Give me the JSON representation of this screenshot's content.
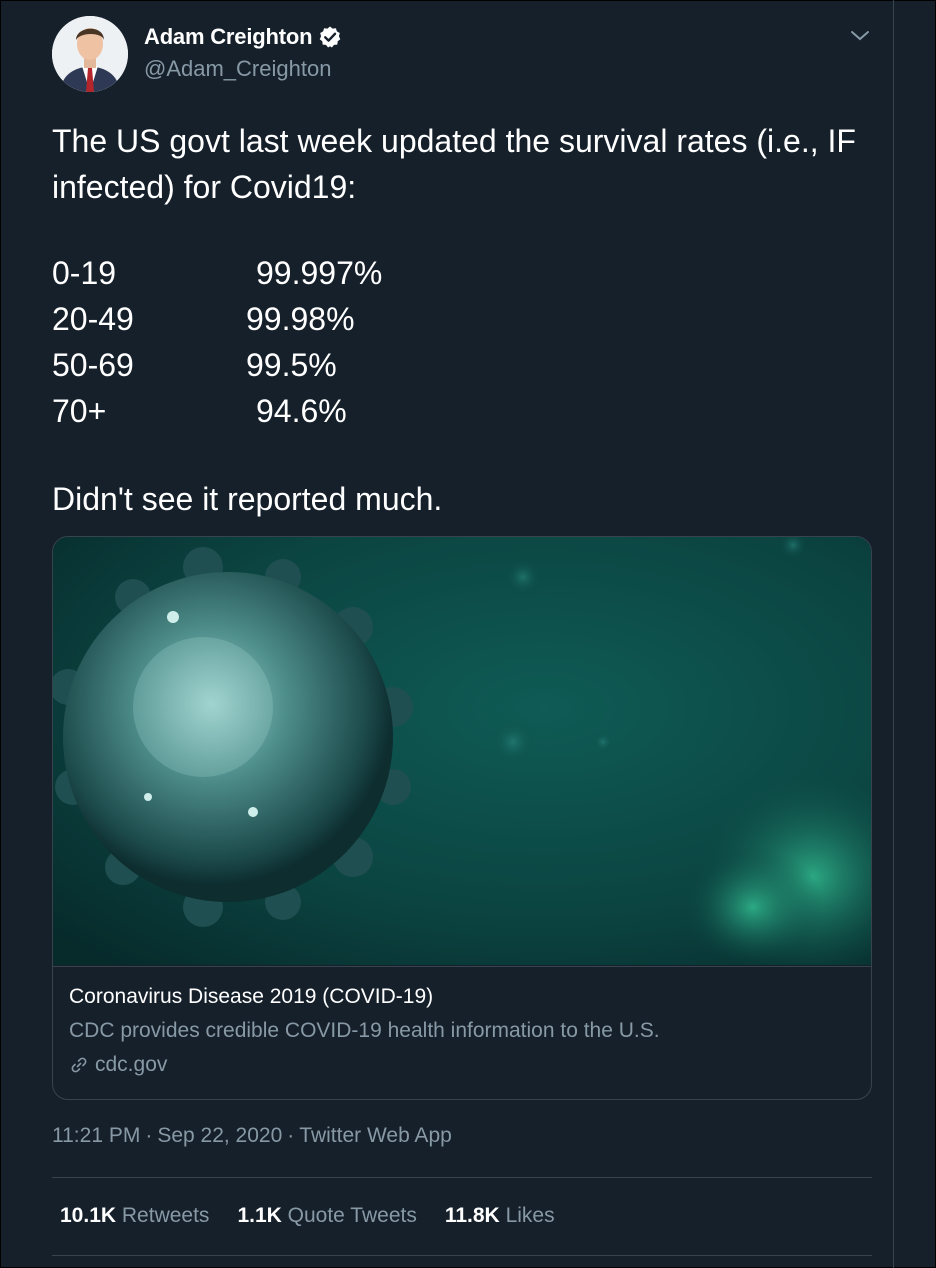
{
  "author": {
    "name": "Adam Creighton",
    "handle": "@Adam_Creighton",
    "verified": true,
    "avatar": "avatar-photo"
  },
  "icons": {
    "verified": "verified-badge-icon",
    "menu": "chevron-down-icon",
    "link": "link-icon"
  },
  "tweet": {
    "intro": "The US govt last week updated the survival rates (i.e., IF infected) for Covid19:",
    "rates": [
      {
        "age": "0-19",
        "rate": "99.997%"
      },
      {
        "age": "20-49",
        "rate": "99.98%"
      },
      {
        "age": "50-69",
        "rate": "99.5%"
      },
      {
        "age": "70+",
        "rate": "94.6%"
      }
    ],
    "closing": "Didn't see it reported much."
  },
  "card": {
    "title": "Coronavirus Disease 2019 (COVID-19)",
    "description": "CDC provides credible COVID-19 health information to the U.S.",
    "domain": "cdc.gov"
  },
  "meta": {
    "time": "11:21 PM",
    "date": "Sep 22, 2020",
    "source": "Twitter Web App"
  },
  "stats": {
    "retweets": {
      "count": "10.1K",
      "label": "Retweets"
    },
    "quotes": {
      "count": "1.1K",
      "label": "Quote Tweets"
    },
    "likes": {
      "count": "11.8K",
      "label": "Likes"
    }
  },
  "colors": {
    "background": "#15202b",
    "secondary_text": "#8899a6",
    "border": "#38444d",
    "accent_teal": "#0f5b55"
  }
}
